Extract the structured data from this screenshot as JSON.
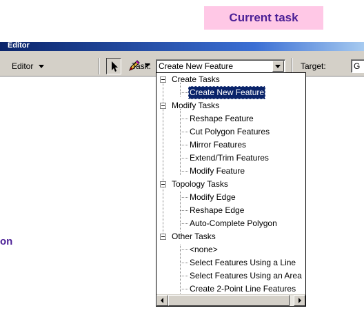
{
  "callout": {
    "text": "Current task"
  },
  "side_label": {
    "text": "on"
  },
  "window": {
    "title": "Editor"
  },
  "toolbar": {
    "editor_menu": "Editor",
    "task_label": "Task:",
    "task_value": "Create New Feature",
    "target_label": "Target:",
    "target_value": "G"
  },
  "tree": {
    "groups": [
      {
        "label": "Create Tasks",
        "items": [
          "Create New Feature"
        ]
      },
      {
        "label": "Modify Tasks",
        "items": [
          "Reshape Feature",
          "Cut Polygon Features",
          "Mirror Features",
          "Extend/Trim Features",
          "Modify Feature"
        ]
      },
      {
        "label": "Topology Tasks",
        "items": [
          "Modify Edge",
          "Reshape Edge",
          "Auto-Complete Polygon"
        ]
      },
      {
        "label": "Other Tasks",
        "items": [
          "<none>",
          "Select Features Using a Line",
          "Select Features Using an Area",
          "Create 2-Point Line Features"
        ]
      }
    ],
    "selected": "Create New Feature"
  },
  "colors": {
    "callout_bg": "#ffc8e6",
    "callout_text": "#4b1f96",
    "title_bar": "#0a246a",
    "selection": "#0a246a",
    "toolbar_bg": "#d4d0c8"
  }
}
